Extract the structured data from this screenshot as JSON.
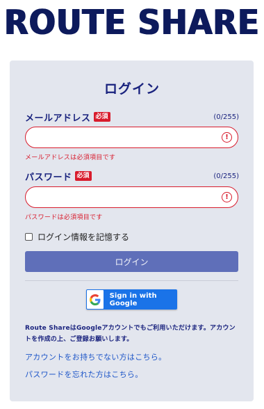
{
  "brand": {
    "logo_text": "ROUTE SHARE"
  },
  "form": {
    "title": "ログイン",
    "email": {
      "label": "メールアドレス",
      "required_badge": "必須",
      "counter": "(0/255)",
      "value": "",
      "placeholder": "",
      "error": "メールアドレスは必須項目です"
    },
    "password": {
      "label": "パスワード",
      "required_badge": "必須",
      "counter": "(0/255)",
      "value": "",
      "placeholder": "",
      "error": "パスワードは必須項目です"
    },
    "remember_label": "ログイン情報を記憶する",
    "remember_checked": false,
    "submit_label": "ログイン",
    "google_label": "Sign in with Google",
    "note": "Route ShareはGoogleアカウントでもご利用いただけます。アカウントを作成の上、ご登録お願いします。",
    "links": {
      "no_account": "アカウントをお持ちでない方はこちら。",
      "forgot_password": "パスワードを忘れた方はこちら。"
    }
  },
  "colors": {
    "navy": "#1a237e",
    "error_red": "#d81b2c",
    "button": "#5f6fb9",
    "google_blue": "#1a73e8",
    "card_bg": "#e3e6ee",
    "link": "#1e56c8"
  },
  "icons": {
    "error": "exclamation-circle",
    "google": "google-g-logo",
    "checkbox": "checkbox-unchecked"
  }
}
